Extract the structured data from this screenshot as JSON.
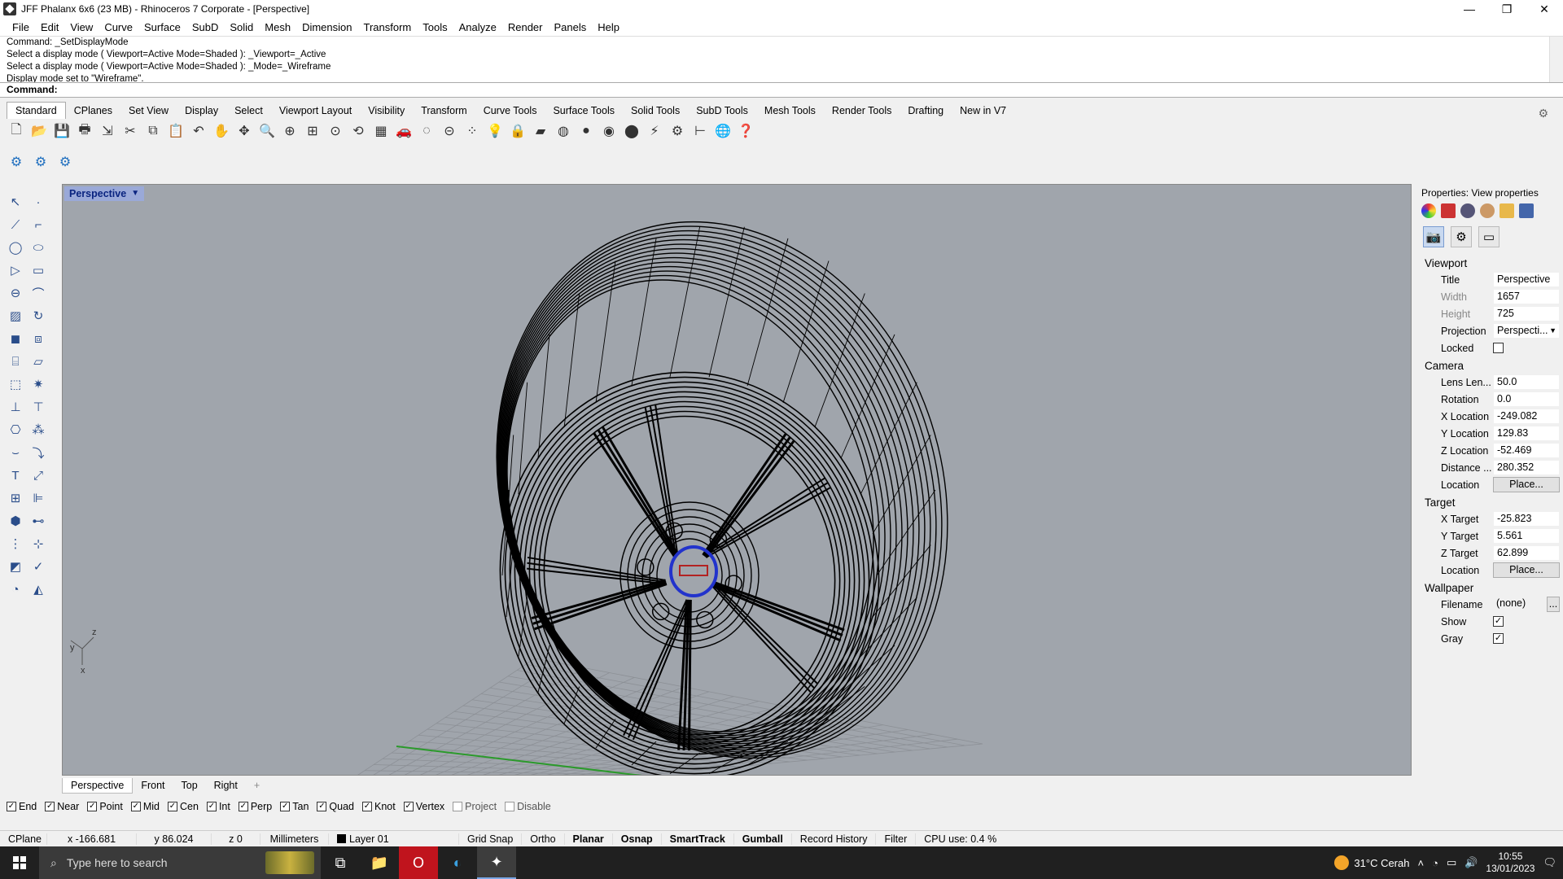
{
  "window": {
    "title": "JFF Phalanx 6x6 (23 MB) - Rhinoceros 7 Corporate - [Perspective]",
    "minimize": "—",
    "maximize": "❐",
    "close": "✕"
  },
  "menu": [
    "File",
    "Edit",
    "View",
    "Curve",
    "Surface",
    "SubD",
    "Solid",
    "Mesh",
    "Dimension",
    "Transform",
    "Tools",
    "Analyze",
    "Render",
    "Panels",
    "Help"
  ],
  "command": {
    "history": [
      "Command: _SetDisplayMode",
      "Select a display mode ( Viewport=Active  Mode=Shaded ): _Viewport=_Active",
      "Select a display mode ( Viewport=Active  Mode=Shaded ): _Mode=_Wireframe",
      "Display mode set to \"Wireframe\"."
    ],
    "prompt": "Command:"
  },
  "toolbar_tabs": [
    "Standard",
    "CPlanes",
    "Set View",
    "Display",
    "Select",
    "Viewport Layout",
    "Visibility",
    "Transform",
    "Curve Tools",
    "Surface Tools",
    "Solid Tools",
    "SubD Tools",
    "Mesh Tools",
    "Render Tools",
    "Drafting",
    "New in V7"
  ],
  "viewport": {
    "name": "Perspective",
    "axes": {
      "x": "x",
      "y": "y",
      "z": "z"
    },
    "tabs": [
      "Perspective",
      "Front",
      "Top",
      "Right"
    ],
    "add_tab": "+",
    "colors": {
      "background": "#a0a5ac",
      "wire": "#000000",
      "grid": "#8c9096",
      "x_axis": "#2b9a2b",
      "hub": "#2233cc",
      "logo": "#b22222"
    }
  },
  "panel": {
    "title": "Properties: View properties",
    "viewport_section": "Viewport",
    "viewport": [
      {
        "label": "Title",
        "value": "Perspective",
        "dim": false
      },
      {
        "label": "Width",
        "value": "1657",
        "dim": true
      },
      {
        "label": "Height",
        "value": "725",
        "dim": true
      },
      {
        "label": "Projection",
        "value": "Perspecti...",
        "dim": false
      }
    ],
    "locked_label": "Locked",
    "camera_section": "Camera",
    "camera": [
      {
        "label": "Lens Len...",
        "value": "50.0"
      },
      {
        "label": "Rotation",
        "value": "0.0"
      },
      {
        "label": "X Location",
        "value": "-249.082"
      },
      {
        "label": "Y Location",
        "value": "129.83"
      },
      {
        "label": "Z Location",
        "value": "-52.469"
      },
      {
        "label": "Distance ...",
        "value": "280.352"
      }
    ],
    "location_label": "Location",
    "place_button": "Place...",
    "target_section": "Target",
    "target": [
      {
        "label": "X Target",
        "value": "-25.823"
      },
      {
        "label": "Y Target",
        "value": "5.561"
      },
      {
        "label": "Z Target",
        "value": "62.899"
      }
    ],
    "wallpaper_section": "Wallpaper",
    "filename_label": "Filename",
    "filename_value": "(none)",
    "browse": "...",
    "show_label": "Show",
    "gray_label": "Gray"
  },
  "osnap": [
    {
      "label": "End",
      "checked": true
    },
    {
      "label": "Near",
      "checked": true
    },
    {
      "label": "Point",
      "checked": true
    },
    {
      "label": "Mid",
      "checked": true
    },
    {
      "label": "Cen",
      "checked": true
    },
    {
      "label": "Int",
      "checked": true
    },
    {
      "label": "Perp",
      "checked": true
    },
    {
      "label": "Tan",
      "checked": true
    },
    {
      "label": "Quad",
      "checked": true
    },
    {
      "label": "Knot",
      "checked": true
    },
    {
      "label": "Vertex",
      "checked": true
    },
    {
      "label": "Project",
      "checked": false
    },
    {
      "label": "Disable",
      "checked": false
    }
  ],
  "status": {
    "cplane": "CPlane",
    "x": "x -166.681",
    "y": "y 86.024",
    "z": "z 0",
    "units": "Millimeters",
    "layer": "Layer 01",
    "grid_snap": "Grid Snap",
    "ortho": "Ortho",
    "planar": "Planar",
    "osnap": "Osnap",
    "smarttrack": "SmartTrack",
    "gumball": "Gumball",
    "record_history": "Record History",
    "filter": "Filter",
    "cpu": "CPU use: 0.4 %"
  },
  "taskbar": {
    "search_placeholder": "Type here to search",
    "weather": "31°C  Cerah",
    "time": "10:55",
    "date": "13/01/2023"
  }
}
